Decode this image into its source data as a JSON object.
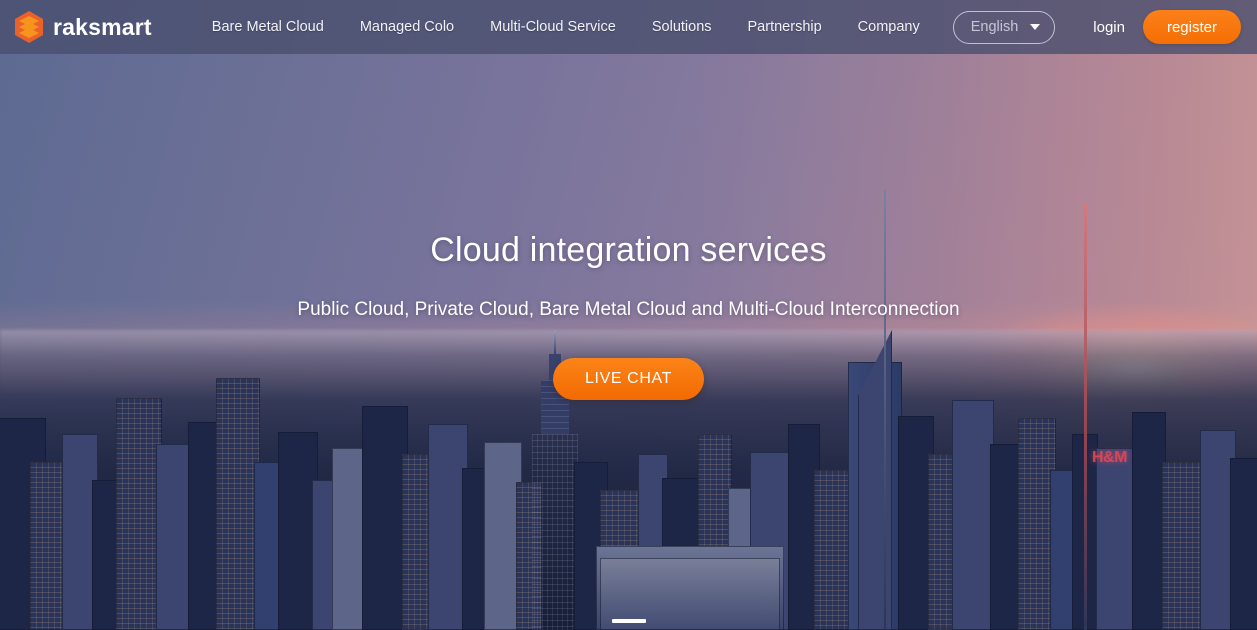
{
  "brand": {
    "name": "raksmart",
    "logo_icon": "hexagon-stack-logo-icon",
    "accent_color": "#f97316"
  },
  "nav": {
    "links": [
      {
        "label": "Bare Metal Cloud"
      },
      {
        "label": "Managed Colo"
      },
      {
        "label": "Multi-Cloud Service"
      },
      {
        "label": "Solutions"
      },
      {
        "label": "Partnership"
      },
      {
        "label": "Company"
      }
    ],
    "language": {
      "selected": "English",
      "caret_icon": "chevron-down-icon"
    },
    "login_label": "login",
    "register_label": "register",
    "background_color": "#4a4f6e",
    "register_color": "#f97316"
  },
  "hero": {
    "title": "Cloud integration services",
    "subtitle": "Public Cloud, Private Cloud, Bare Metal Cloud and Multi-Cloud Interconnection",
    "cta_label": "LIVE CHAT",
    "cta_color": "#f97316",
    "background_description": "New York City skyline at sunset with Empire State Building",
    "carousel": {
      "total_slides": 1,
      "active_slide": 1
    }
  }
}
